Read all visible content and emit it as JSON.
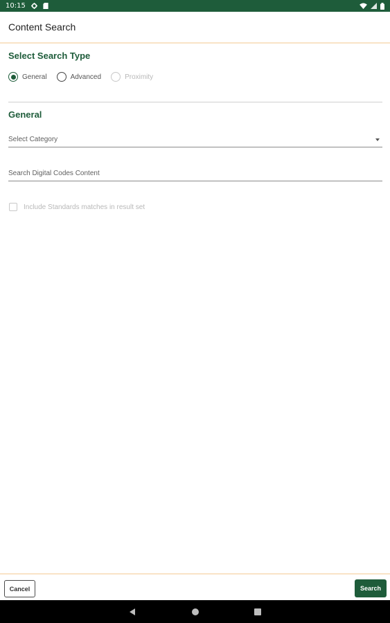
{
  "status_bar": {
    "time": "10:15",
    "icons": [
      "settings-icon",
      "sd-card-icon",
      "wifi-icon",
      "signal-icon",
      "battery-icon"
    ]
  },
  "app_bar": {
    "title": "Content Search"
  },
  "search_type": {
    "heading": "Select Search Type",
    "options": [
      {
        "label": "General",
        "checked": true,
        "disabled": false
      },
      {
        "label": "Advanced",
        "checked": false,
        "disabled": false
      },
      {
        "label": "Proximity",
        "checked": false,
        "disabled": true
      }
    ]
  },
  "general": {
    "heading": "General",
    "category_placeholder": "Select Category",
    "search_placeholder": "Search Digital Codes Content",
    "search_value": "",
    "include_standards_label": "Include Standards matches in result set",
    "include_standards_checked": false
  },
  "actions": {
    "cancel_label": "Cancel",
    "search_label": "Search"
  },
  "nav": {
    "icons": [
      "back-icon",
      "home-icon",
      "recents-icon"
    ]
  },
  "colors": {
    "primary": "#1e5c3a",
    "accent_line": "#f9e3c6",
    "nav_bg": "#000000"
  }
}
